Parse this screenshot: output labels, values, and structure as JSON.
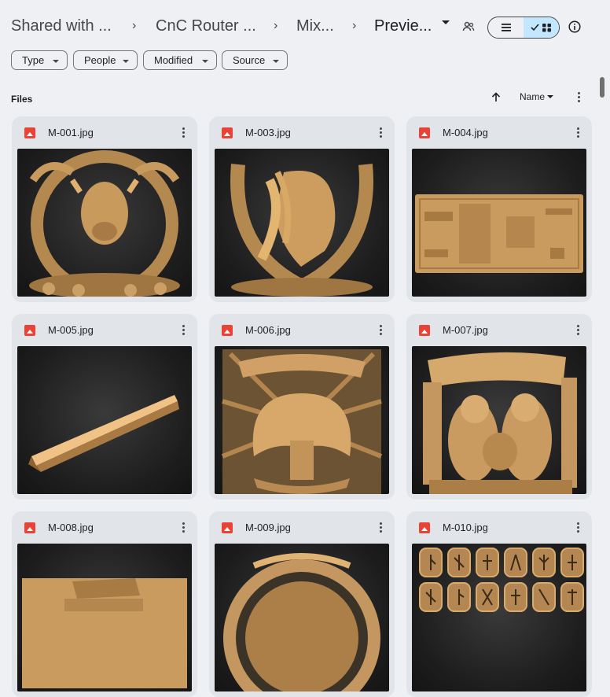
{
  "breadcrumbs": [
    "Shared with ...",
    "CnC Router ...",
    "Mix...",
    "Previe..."
  ],
  "filters": [
    "Type",
    "People",
    "Modified",
    "Source"
  ],
  "section_label": "Files",
  "sort": {
    "label": "Name"
  },
  "colors": {
    "accent": "#c2e7ff",
    "background": "#eef0f4",
    "card": "#e1e5ea",
    "file_icon": "#ea4335"
  },
  "files": [
    {
      "name": "M-001.jpg",
      "thumb": "bull-horseshoe-relief"
    },
    {
      "name": "M-003.jpg",
      "thumb": "horse-horseshoe-relief"
    },
    {
      "name": "M-004.jpg",
      "thumb": "banknote-1000-relief"
    },
    {
      "name": "M-005.jpg",
      "thumb": "molding-profile"
    },
    {
      "name": "M-006.jpg",
      "thumb": "never-forget-eagle-relief"
    },
    {
      "name": "M-007.jpg",
      "thumb": "old-couple-banner-relief"
    },
    {
      "name": "M-008.jpg",
      "thumb": "world-of-tanks-relief"
    },
    {
      "name": "M-009.jpg",
      "thumb": "round-plaque-relief"
    },
    {
      "name": "M-010.jpg",
      "thumb": "runes-set"
    }
  ],
  "icons": [
    "chevron-right-icon",
    "dropdown-icon",
    "people-icon",
    "list-view-icon",
    "grid-view-icon",
    "info-icon",
    "arrow-up-icon",
    "more-vert-icon",
    "image-file-icon"
  ]
}
